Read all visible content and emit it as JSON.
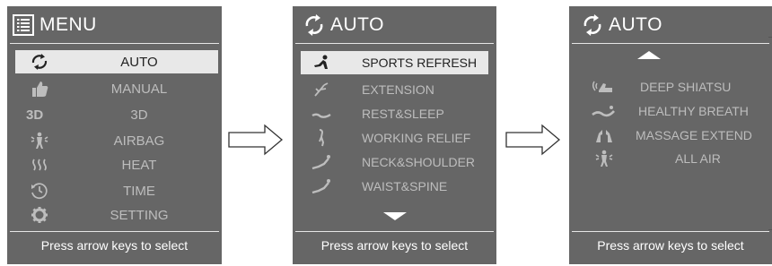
{
  "menu_screen": {
    "title": "MENU",
    "items": [
      {
        "label": "AUTO",
        "icon": "auto-cycle-icon",
        "selected": true
      },
      {
        "label": "MANUAL",
        "icon": "thumbs-up-icon",
        "selected": false
      },
      {
        "label": "3D",
        "icon": "3d-icon",
        "selected": false
      },
      {
        "label": "AIRBAG",
        "icon": "airbag-person-icon",
        "selected": false
      },
      {
        "label": "HEAT",
        "icon": "heat-waves-icon",
        "selected": false
      },
      {
        "label": "TIME",
        "icon": "clock-icon",
        "selected": false
      },
      {
        "label": "SETTING",
        "icon": "gear-icon",
        "selected": false
      }
    ],
    "footer": "Press arrow keys to select"
  },
  "auto_screen_1": {
    "title": "AUTO",
    "items": [
      {
        "label": "SPORTS REFRESH",
        "icon": "sports-person-icon",
        "selected": true
      },
      {
        "label": "EXTENSION",
        "icon": "stretch-figure-icon",
        "selected": false
      },
      {
        "label": "REST&SLEEP",
        "icon": "reclined-figure-icon",
        "selected": false
      },
      {
        "label": "WORKING RELIEF",
        "icon": "standing-figure-icon",
        "selected": false
      },
      {
        "label": "NECK&SHOULDER",
        "icon": "neck-recline-icon",
        "selected": false
      },
      {
        "label": "WAIST&SPINE",
        "icon": "spine-recline-icon",
        "selected": false
      }
    ],
    "more_indicator": "scroll-down-arrow-icon",
    "footer": "Press arrow keys to select"
  },
  "auto_screen_2": {
    "title": "AUTO",
    "items": [
      {
        "label": "DEEP SHIATSU",
        "icon": "shiatsu-hand-icon",
        "selected": false
      },
      {
        "label": "HEALTHY BREATH",
        "icon": "breath-recline-icon",
        "selected": false
      },
      {
        "label": "MASSAGE EXTEND",
        "icon": "massage-extend-icon",
        "selected": false
      },
      {
        "label": "ALL AIR",
        "icon": "all-air-figure-icon",
        "selected": false
      }
    ],
    "more_indicator": "scroll-up-arrow-icon",
    "footer": "Press arrow keys to select"
  },
  "colors": {
    "panel_bg": "#666666",
    "selected_bg": "#e8e8e8",
    "text_active": "#ffffff",
    "text_dim": "#bdbdbd",
    "selected_text": "#222222"
  }
}
